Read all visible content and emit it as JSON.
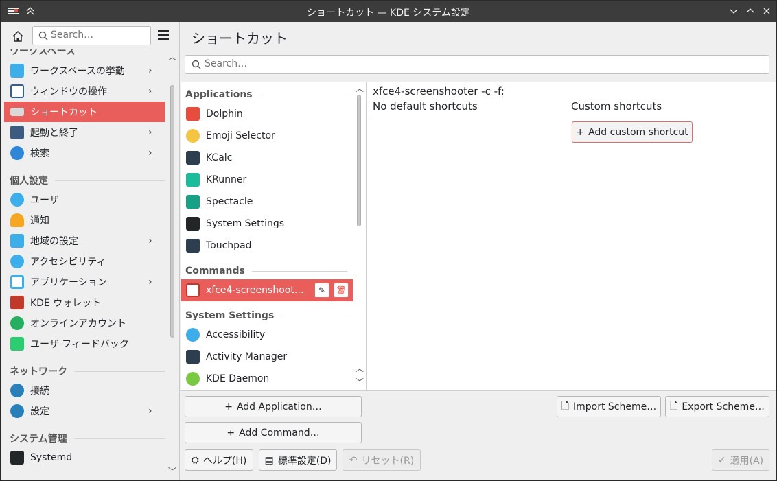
{
  "window": {
    "title": "ショートカット — KDE システム設定"
  },
  "sidebar": {
    "search_placeholder": "Search…",
    "sections": [
      {
        "label": "ワークスペース"
      },
      {
        "label": "個人設定"
      },
      {
        "label": "ネットワーク"
      },
      {
        "label": "システム管理"
      }
    ],
    "items": [
      {
        "label": "ワークスペースの挙動",
        "chevron": true,
        "icon": "workspace-behavior-icon",
        "color": "#3daee9"
      },
      {
        "label": "ウィンドウの操作",
        "chevron": true,
        "icon": "window-management-icon",
        "color": "#2d5fa3"
      },
      {
        "label": "ショートカット",
        "chevron": false,
        "icon": "keyboard-icon",
        "color": "#b0b0b0",
        "selected": true
      },
      {
        "label": "起動と終了",
        "chevron": true,
        "icon": "startup-icon",
        "color": "#3d5a80"
      },
      {
        "label": "検索",
        "chevron": true,
        "icon": "search-icon",
        "color": "#2f86d6"
      },
      {
        "label": "ユーザ",
        "chevron": false,
        "icon": "users-icon",
        "color": "#3daee9"
      },
      {
        "label": "通知",
        "chevron": false,
        "icon": "bell-icon",
        "color": "#f5a623"
      },
      {
        "label": "地域の設定",
        "chevron": true,
        "icon": "regional-icon",
        "color": "#3daee9"
      },
      {
        "label": "アクセシビリティ",
        "chevron": false,
        "icon": "accessibility-icon",
        "color": "#3daee9"
      },
      {
        "label": "アプリケーション",
        "chevron": true,
        "icon": "applications-icon",
        "color": "#3daee9"
      },
      {
        "label": "KDE ウォレット",
        "chevron": false,
        "icon": "wallet-icon",
        "color": "#c0392b"
      },
      {
        "label": "オンラインアカウント",
        "chevron": false,
        "icon": "online-accounts-icon",
        "color": "#27ae60"
      },
      {
        "label": "ユーザ フィードバック",
        "chevron": false,
        "icon": "feedback-icon",
        "color": "#2ecc71"
      },
      {
        "label": "接続",
        "chevron": false,
        "icon": "globe-icon",
        "color": "#2980b9"
      },
      {
        "label": "設定",
        "chevron": true,
        "icon": "network-settings-icon",
        "color": "#2980b9"
      },
      {
        "label": "Systemd",
        "chevron": false,
        "icon": "systemd-icon",
        "color": "#232629"
      }
    ]
  },
  "main": {
    "title": "ショートカット",
    "search_placeholder": "Search…",
    "groups": [
      {
        "label": "Applications"
      },
      {
        "label": "Commands"
      },
      {
        "label": "System Settings"
      }
    ],
    "apps": [
      {
        "label": "Dolphin",
        "icon": "dolphin-icon",
        "color": "#e74c3c"
      },
      {
        "label": "Emoji Selector",
        "icon": "emoji-icon",
        "color": "#f5c542"
      },
      {
        "label": "KCalc",
        "icon": "calculator-icon",
        "color": "#2c3e50"
      },
      {
        "label": "KRunner",
        "icon": "krunner-icon",
        "color": "#1abc9c"
      },
      {
        "label": "Spectacle",
        "icon": "spectacle-icon",
        "color": "#16a085"
      },
      {
        "label": "System Settings",
        "icon": "system-settings-icon",
        "color": "#232629"
      },
      {
        "label": "Touchpad",
        "icon": "touchpad-icon",
        "color": "#2c3e50"
      }
    ],
    "commands": [
      {
        "label": "xfce4-screenshoot…",
        "icon": "command-icon",
        "color": "#e74c3c",
        "selected": true
      }
    ],
    "system_settings": [
      {
        "label": "Accessibility",
        "icon": "accessibility-icon",
        "color": "#3daee9"
      },
      {
        "label": "Activity Manager",
        "icon": "activity-manager-icon",
        "color": "#2c3e50"
      },
      {
        "label": "KDE Daemon",
        "icon": "kde-daemon-icon",
        "color": "#7ac943"
      }
    ],
    "detail": {
      "command": "xfce4-screenshooter -c -f:",
      "default_header": "No default shortcuts",
      "custom_header": "Custom shortcuts",
      "add_custom_label": "Add custom shortcut"
    },
    "buttons": {
      "add_application": "Add Application…",
      "add_command": "Add Command…",
      "import_scheme": "Import Scheme…",
      "export_scheme": "Export Scheme…",
      "help": "ヘルプ(H)",
      "defaults": "標準設定(D)",
      "reset": "リセット(R)",
      "apply": "適用(A)"
    }
  }
}
